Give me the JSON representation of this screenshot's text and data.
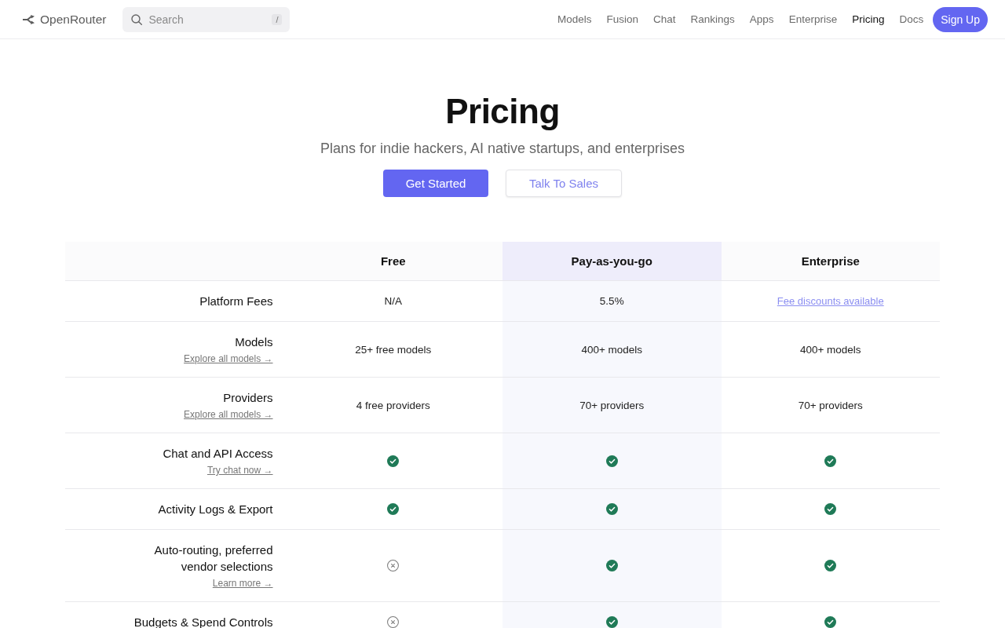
{
  "header": {
    "logo": "OpenRouter",
    "search": {
      "placeholder": "Search",
      "shortcut": "/"
    },
    "nav": [
      {
        "label": "Models",
        "selected": false
      },
      {
        "label": "Fusion",
        "selected": false
      },
      {
        "label": "Chat",
        "selected": false
      },
      {
        "label": "Rankings",
        "selected": false
      },
      {
        "label": "Apps",
        "selected": false
      },
      {
        "label": "Enterprise",
        "selected": false
      },
      {
        "label": "Pricing",
        "selected": true
      },
      {
        "label": "Docs",
        "selected": false
      }
    ],
    "sign_up": "Sign Up"
  },
  "hero": {
    "title": "Pricing",
    "subtitle": "Plans for indie hackers, AI native startups, and enterprises",
    "buttons": [
      {
        "label": "Get Started",
        "kind": "primary"
      },
      {
        "label": "Talk To Sales",
        "kind": "secondary"
      }
    ]
  },
  "table": {
    "columns": [
      {
        "label": "Free",
        "highlighted": false
      },
      {
        "label": "Pay-as-you-go",
        "highlighted": true
      },
      {
        "label": "Enterprise",
        "highlighted": false
      }
    ],
    "rows": [
      {
        "feature": "Platform Fees",
        "cells": [
          {
            "kind": "text",
            "text": "N/A"
          },
          {
            "kind": "text",
            "text": "5.5%"
          },
          {
            "kind": "link",
            "text": "Fee discounts available"
          }
        ]
      },
      {
        "feature": "Models",
        "link": "Explore all models →",
        "cells": [
          {
            "kind": "text",
            "text": "25+ free models"
          },
          {
            "kind": "text",
            "text": "400+ models"
          },
          {
            "kind": "text",
            "text": "400+ models"
          }
        ]
      },
      {
        "feature": "Providers",
        "link": "Explore all models →",
        "cells": [
          {
            "kind": "text",
            "text": "4 free providers"
          },
          {
            "kind": "text",
            "text": "70+ providers"
          },
          {
            "kind": "text",
            "text": "70+ providers"
          }
        ]
      },
      {
        "feature": "Chat and API Access",
        "link": "Try chat now →",
        "cells": [
          {
            "kind": "mark",
            "included": true
          },
          {
            "kind": "mark",
            "included": true
          },
          {
            "kind": "mark",
            "included": true
          }
        ]
      },
      {
        "feature": "Activity Logs & Export",
        "cells": [
          {
            "kind": "mark",
            "included": true
          },
          {
            "kind": "mark",
            "included": true
          },
          {
            "kind": "mark",
            "included": true
          }
        ]
      },
      {
        "feature": "Auto-routing, preferred vendor selections",
        "link": "Learn more →",
        "cells": [
          {
            "kind": "mark",
            "included": false
          },
          {
            "kind": "mark",
            "included": true
          },
          {
            "kind": "mark",
            "included": true
          }
        ]
      },
      {
        "feature": "Budgets & Spend Controls",
        "cells": [
          {
            "kind": "mark",
            "included": false
          },
          {
            "kind": "mark",
            "included": true
          },
          {
            "kind": "mark",
            "included": true
          }
        ]
      }
    ]
  }
}
